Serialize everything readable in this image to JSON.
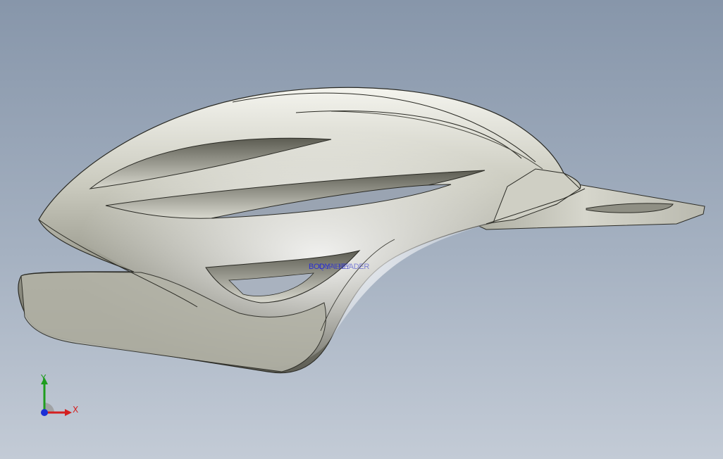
{
  "viewport": {
    "model_labels": [
      "BODY",
      "QUALITY",
      "PIPE",
      "HEADER"
    ],
    "label_color": "#2a2fcf",
    "background_top": "#8796aa",
    "background_bottom": "#c3cbd6"
  },
  "triad": {
    "x_label": "X",
    "y_label": "Y",
    "x_color": "#d42020",
    "y_color": "#1f9d1f",
    "z_color": "#1b2fd6"
  }
}
